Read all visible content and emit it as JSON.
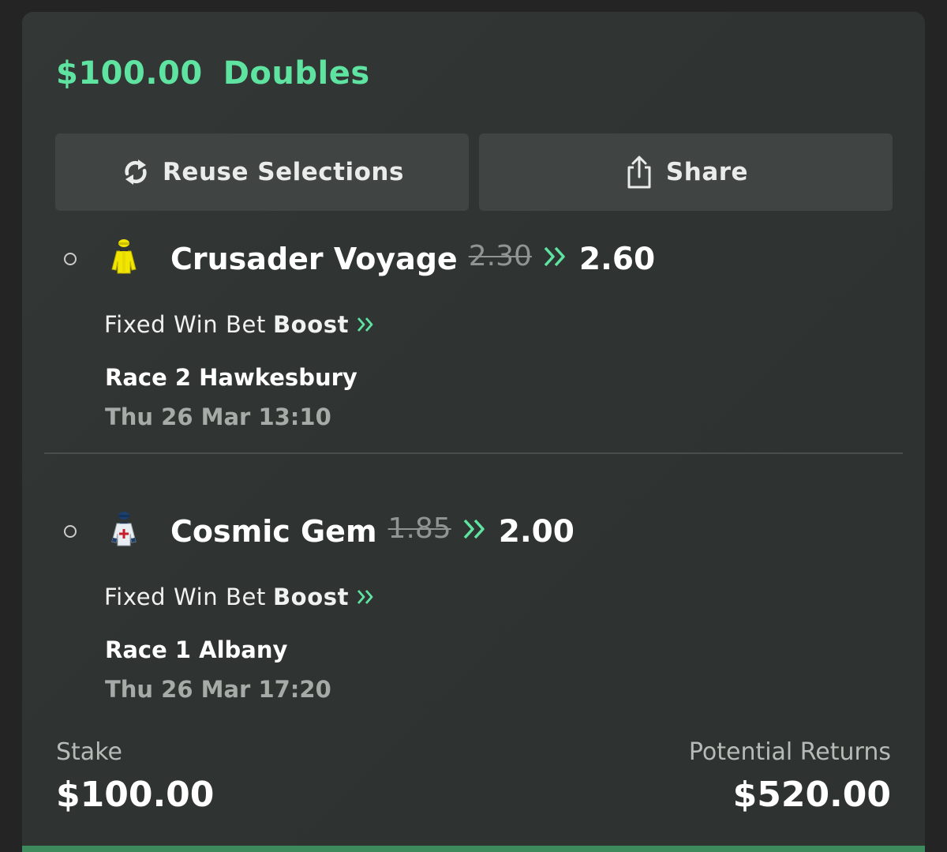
{
  "bet": {
    "amount": "$100.00",
    "type": "Doubles"
  },
  "actions": {
    "reuse_label": "Reuse Selections",
    "share_label": "Share"
  },
  "selections": [
    {
      "runner": "Crusader Voyage",
      "old_odds": "2.30",
      "new_odds": "2.60",
      "bet_type": "Fixed Win Bet",
      "boost_label": "Boost",
      "race": "Race 2 Hawkesbury",
      "time": "Thu 26 Mar 13:10",
      "silk_color": "#f2e600"
    },
    {
      "runner": "Cosmic Gem",
      "old_odds": "1.85",
      "new_odds": "2.00",
      "bet_type": "Fixed Win Bet",
      "boost_label": "Boost",
      "race": "Race 1 Albany",
      "time": "Thu 26 Mar 17:20",
      "silk_color": "#e8eef2"
    }
  ],
  "summary": {
    "stake_label": "Stake",
    "stake_value": "$100.00",
    "returns_label": "Potential Returns",
    "returns_value": "$520.00"
  },
  "colors": {
    "accent": "#5fe3a1",
    "card_bg": "#313533",
    "button_bg": "#404543"
  },
  "icons": {
    "reuse": "refresh-icon",
    "share": "share-icon",
    "boost": "double-chevron-right-icon",
    "silk": "jockey-silk-icon"
  }
}
